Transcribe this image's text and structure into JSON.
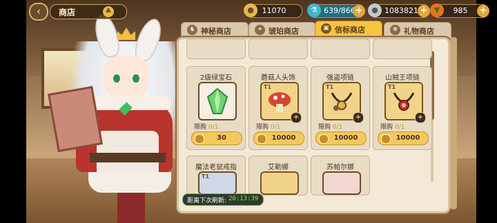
{
  "header": {
    "back_icon": "back-arrow-icon",
    "title": "商店",
    "title_icon": "clover-icon"
  },
  "resources": [
    {
      "icon": "gold-coin-icon",
      "value": "11070",
      "color": "#e6b84a"
    },
    {
      "icon": "stamina-potion-icon",
      "value": "639/866",
      "color": "#3fb7c9"
    },
    {
      "icon": "silver-coin-icon",
      "value": "1083821",
      "color": "#c7c7c7"
    },
    {
      "icon": "carrot-icon",
      "value": "985",
      "color": "#e8731f"
    }
  ],
  "tabs": [
    {
      "label": "神秘商店",
      "icon": "cat-icon",
      "active": false
    },
    {
      "label": "琥珀商店",
      "icon": "amber-icon",
      "active": false
    },
    {
      "label": "信标商店",
      "icon": "beacon-icon",
      "active": true
    },
    {
      "label": "礼物商店",
      "icon": "gift-icon",
      "active": false
    }
  ],
  "items": [
    {
      "name": "2级绿宝石",
      "tag": "",
      "icon": "green-gem-icon",
      "limit_label": "限购",
      "limit": "0/1",
      "price": "30"
    },
    {
      "name": "蘑菇人头饰",
      "tag": "T1",
      "icon": "mushroom-headwear-icon",
      "limit_label": "限购",
      "limit": "0/1",
      "price": "10000"
    },
    {
      "name": "强盗项链",
      "tag": "T1",
      "icon": "bandit-necklace-icon",
      "limit_label": "限购",
      "limit": "0/1",
      "price": "10000"
    },
    {
      "name": "山贼王项链",
      "tag": "T1",
      "icon": "bandit-king-necklace-icon",
      "limit_label": "限购",
      "limit": "0/1",
      "price": "10000"
    },
    {
      "name": "魔法老鼠戒指",
      "tag": "T1",
      "icon": "magic-mouse-ring-icon"
    },
    {
      "name": "艾勒娜",
      "tag": "",
      "icon": "character-portrait-icon"
    },
    {
      "name": "苏帕尔娜",
      "tag": "",
      "icon": "character-portrait-icon"
    }
  ],
  "refresh": {
    "label": "距离下次刷新:",
    "time": "20:13:39"
  }
}
